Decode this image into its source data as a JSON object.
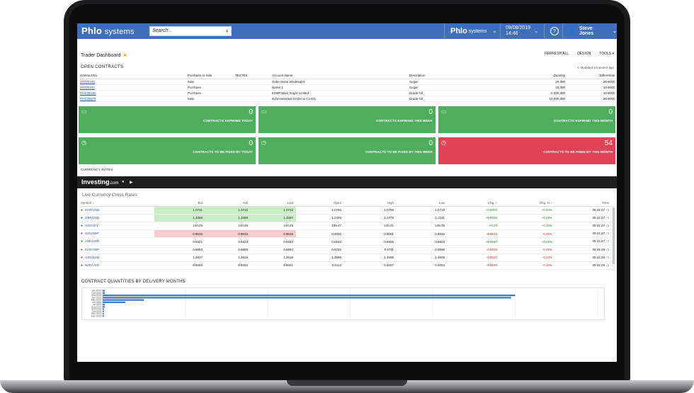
{
  "nav": {
    "brand": "Phlo",
    "brand_sub": "systems",
    "search_placeholder": "Search...",
    "brand2": "Phlo",
    "brand2_sub": "systems",
    "date": "09/08/2019",
    "time": "14:46",
    "help": "?",
    "user": "Steve Jones",
    "colors": {
      "nav_bg": "#3f6fb8"
    }
  },
  "header": {
    "title": "Trader Dashboard",
    "actions": [
      "REFRESH ALL",
      "DESIGN",
      "TOOLS ▾"
    ]
  },
  "open_contracts": {
    "title": "OPEN CONTRACTS",
    "updated": "Updated a moment ago",
    "columns": [
      "Contract No.",
      "Purchase or Sale",
      "TESTES",
      "Account Name",
      "Description",
      "Quantity",
      "Differential"
    ],
    "rows": [
      [
        "SAT00195",
        "Sale",
        "",
        "Gidel Stone wholesaler",
        "Sugar",
        "20.000",
        "20.0000"
      ],
      [
        "SAT00194",
        "Purchase",
        "",
        "Name 1",
        "Sugar",
        "10.000",
        "10.0000"
      ],
      [
        "OHC00180",
        "Purchase",
        "",
        "EDBP Main Sugar Limited",
        "Crude Oil_",
        "5.000.000",
        "10.0000"
      ],
      [
        "OHC00179",
        "Sale",
        "",
        "Bohnnationsal GmbH & Co KG",
        "Crude Oil_",
        "10.000.000",
        "20.0000"
      ]
    ]
  },
  "tiles": [
    {
      "value": "0",
      "label": "CONTRACTS EXPIRING TODAY",
      "icon": "calendar-icon",
      "color": "#4fae5e"
    },
    {
      "value": "0",
      "label": "CONTRACTS EXPIRING THIS WEEK",
      "icon": "calendar-icon",
      "color": "#4fae5e"
    },
    {
      "value": "0",
      "label": "CONTRACTS EXPIRING THIS MONTH",
      "icon": "calendar-icon",
      "color": "#4fae5e"
    },
    {
      "value": "0",
      "label": "CONTRACTS TO BE FIXED BY TODAY",
      "icon": "clock-icon",
      "color": "#4fae5e"
    },
    {
      "value": "0",
      "label": "CONTRACTS TO BE FIXED BY THIS WEEK",
      "icon": "clock-icon",
      "color": "#4fae5e"
    },
    {
      "value": "54",
      "label": "CONTRACTS TO BE FIXED BY THIS MONTH",
      "icon": "clock-icon",
      "color": "#e04355"
    }
  ],
  "currency": {
    "section_title": "CURRENCY RATES",
    "brand": "Investing",
    "brand_sub": ".com",
    "title": "Live Currency Cross Rates",
    "columns": [
      "Symbol ↕",
      "Bid",
      "Ask",
      "Last",
      "Open",
      "High",
      "Low",
      "Chg. ↕",
      "Chg. % ↕",
      "Time"
    ],
    "rows": [
      {
        "symbol": "EUR/USD",
        "bid": "1.0731",
        "ask": "1.0732",
        "last": "1.0732",
        "open": "1.0750",
        "high": "1.0758",
        "low": "1.0719",
        "chg": "+0.0005",
        "chg_pct": "+0.04%",
        "time": "09:41:27",
        "trend": "up"
      },
      {
        "symbol": "GBP/USD",
        "bid": "1.2356",
        "ask": "1.2358",
        "last": "1.2357",
        "open": "1.2325",
        "high": "1.2376",
        "low": "1.2311",
        "chg": "+0.0036",
        "chg_pct": "+0.29%",
        "time": "09:41:27",
        "trend": "up"
      },
      {
        "symbol": "USD/JPY",
        "bid": "140.25",
        "ask": "140.26",
        "last": "140.25",
        "open": "139.47",
        "high": "140.31",
        "low": "139.35",
        "chg": "+0.20",
        "chg_pct": "+0.16%",
        "time": "09:41:27",
        "trend": "none"
      },
      {
        "symbol": "USD/CHF",
        "bid": "0.9046",
        "ask": "0.9048",
        "last": "0.9046",
        "open": "0.9050",
        "high": "0.9061",
        "low": "0.9036",
        "chg": "-0.0032",
        "chg_pct": "-0.35%",
        "time": "09:41:27",
        "trend": "down"
      },
      {
        "symbol": "AUD/USD",
        "bid": "0.6521",
        "ask": "0.6523",
        "last": "0.6522",
        "open": "0.6543",
        "high": "0.6556",
        "low": "0.6504",
        "chg": "+0.0017",
        "chg_pct": "+0.26%",
        "time": "09:41:27",
        "trend": "none"
      },
      {
        "symbol": "EUR/GBP",
        "bid": "0.8683",
        "ask": "0.8685",
        "last": "0.8684",
        "open": "0.8722",
        "high": "0.8711",
        "low": "0.8696",
        "chg": "-0.0026",
        "chg_pct": "-0.25%",
        "time": "09:41:28",
        "trend": "none"
      },
      {
        "symbol": "USD/CAD",
        "bid": "1.3617",
        "ask": "1.3619",
        "last": "1.3618",
        "open": "1.3595",
        "high": "1.3655",
        "low": "1.3609",
        "chg": "-0.0031",
        "chg_pct": "-0.23%",
        "time": "09:41:28",
        "trend": "none"
      },
      {
        "symbol": "NZD/USD",
        "bid": "0.6060",
        "ask": "0.6062",
        "last": "0.6061",
        "open": "0.6113",
        "high": "0.6097",
        "low": "0.6053",
        "chg": "-0.0020",
        "chg_pct": "-0.13%",
        "time": "09:41:28",
        "trend": "none"
      }
    ]
  },
  "delivery": {
    "title": "CONTRACT QUANTITIES BY DELIVERY MONTHS",
    "chart_data": {
      "type": "bar",
      "orientation": "horizontal",
      "categories": [
        "Jan-2023",
        "Feb-2023",
        "Mar-2023",
        "Apr-2023",
        "May-2023",
        "Jun-2023",
        "Jul-2023",
        "Aug-2023",
        "Sep-2023",
        "Oct-2023",
        "Nov-2023",
        "Dec-2023"
      ],
      "values": [
        0.5,
        0.5,
        100,
        99,
        10,
        5.5,
        0.5,
        0.5,
        0.3,
        0.3,
        0.3,
        0.3
      ],
      "xlim": [
        0,
        120
      ],
      "color": "#3f79c6",
      "grid": true
    }
  }
}
